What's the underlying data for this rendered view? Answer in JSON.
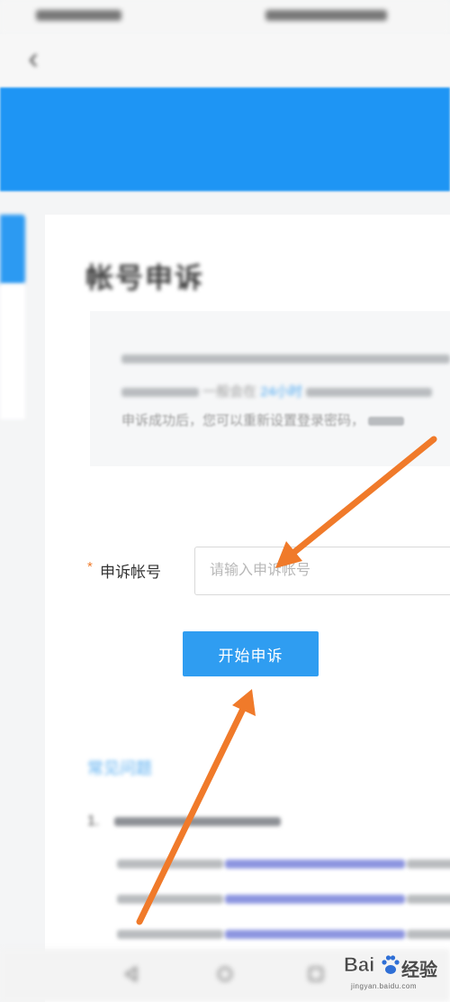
{
  "colors": {
    "banner": "#1e95f4",
    "primary_button": "#2f9df1",
    "required_mark": "#f07b2c",
    "annotation_arrow": "#f07a2a",
    "link_blue": "#4aa6f0"
  },
  "header": {
    "back_icon": "chevron-left-icon",
    "back_glyph": "‹"
  },
  "page": {
    "title": "帐号申诉"
  },
  "notice": {
    "line2_text": "一般会在",
    "line2_highlight": "24小时",
    "line3_text": "申诉成功后，您可以重新设置登录密码，"
  },
  "form": {
    "required_mark": "*",
    "label": "申诉帐号",
    "placeholder": "请输入申诉帐号",
    "value": "",
    "submit_label": "开始申诉"
  },
  "faq": {
    "title": "常见问题",
    "item1_number": "1."
  },
  "bottom_nav": {
    "icons": [
      "nav-back-icon",
      "nav-home-icon",
      "nav-recent-icon"
    ]
  },
  "watermark": {
    "brand": "Bai",
    "suffix": "经验",
    "url": "jingyan.baidu.com"
  }
}
